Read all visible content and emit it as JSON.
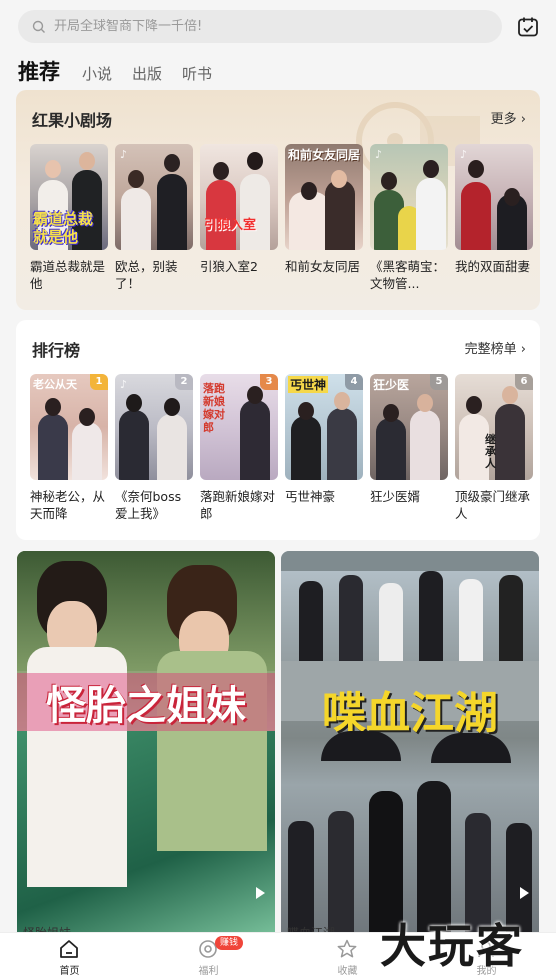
{
  "search": {
    "placeholder": "开局全球智商下降一千倍!"
  },
  "icons": {
    "search": "search-icon",
    "calendar": "calendar-check-icon",
    "tiktok": "tiktok-icon",
    "more": "chevron-right-icon",
    "play": "play-icon"
  },
  "tabs": [
    {
      "label": "推荐",
      "active": true
    },
    {
      "label": "小说"
    },
    {
      "label": "出版"
    },
    {
      "label": "听书"
    }
  ],
  "theater": {
    "title": "红果小剧场",
    "more_label": "更多 ›",
    "items": [
      {
        "title": "霸道总裁就是他",
        "poster_text": "霸道总裁就是他"
      },
      {
        "title": "欧总，别装了！"
      },
      {
        "title": "引狼入室2",
        "poster_text": "引狼入室"
      },
      {
        "title": "和前女友同居",
        "poster_text": "和前女友同居"
      },
      {
        "title": "《黑客萌宝：文物管..."
      },
      {
        "title": "我的双面甜妻"
      }
    ]
  },
  "ranking": {
    "title": "排行榜",
    "more_label": "完整榜单 ›",
    "items": [
      {
        "rank": "1",
        "title": "神秘老公，从天而降",
        "poster_text": "老公从天"
      },
      {
        "rank": "2",
        "title": "《奈何boss爱上我》"
      },
      {
        "rank": "3",
        "title": "落跑新娘嫁对郎",
        "poster_text": "落跑新娘嫁对郎"
      },
      {
        "rank": "4",
        "title": "丐世神豪",
        "poster_text": "丐世神"
      },
      {
        "rank": "5",
        "title": "狂少医婿",
        "poster_text": "狂少医"
      },
      {
        "rank": "6",
        "title": "顶级豪门继承人",
        "poster_text": "继承人"
      }
    ]
  },
  "feed": [
    {
      "poster_text": "怪胎之姐妹",
      "caption": "怪胎姐妹"
    },
    {
      "poster_text": "喋血江湖",
      "caption": "喋血江湖"
    }
  ],
  "bottom_nav": [
    {
      "label": "首页",
      "active": true
    },
    {
      "label": "福利",
      "badge": "赚钱"
    },
    {
      "label": "收藏"
    },
    {
      "label": "我的"
    }
  ],
  "watermark": "大玩客",
  "colors": {
    "accent": "#f0453a",
    "theater_bg": "#efe2cf"
  }
}
